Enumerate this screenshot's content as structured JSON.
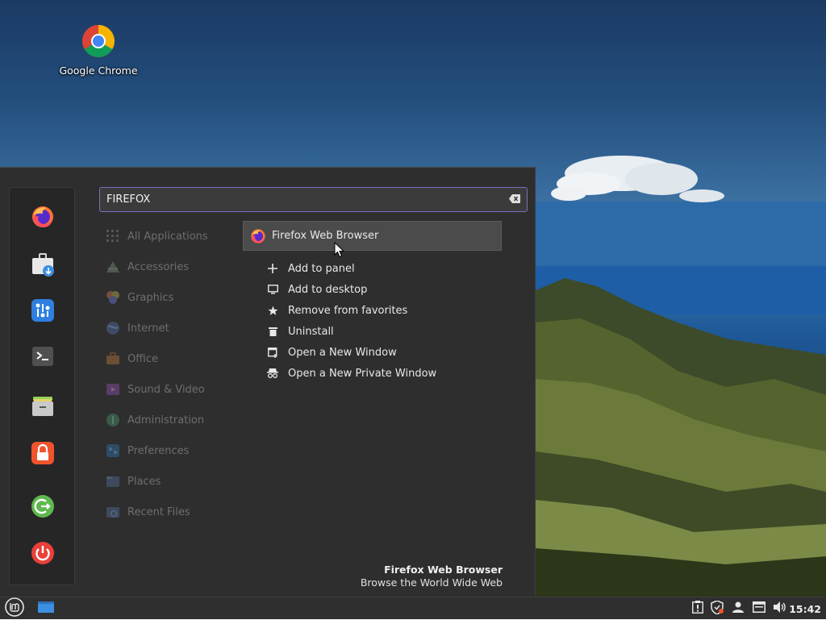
{
  "desktop": {
    "icons": [
      {
        "label": "Google Chrome",
        "icon": "chrome-icon"
      }
    ]
  },
  "menu": {
    "favorites": [
      {
        "name": "Firefox",
        "icon": "firefox-icon"
      },
      {
        "name": "Software Manager",
        "icon": "software-manager-icon"
      },
      {
        "name": "Settings",
        "icon": "settings-icon"
      },
      {
        "name": "Terminal",
        "icon": "terminal-icon"
      },
      {
        "name": "Files",
        "icon": "files-icon"
      },
      {
        "name": "Lock Screen",
        "icon": "lock-icon"
      },
      {
        "name": "Log Out",
        "icon": "logout-icon"
      },
      {
        "name": "Quit",
        "icon": "power-icon"
      }
    ],
    "search": {
      "value": "FIREFOX"
    },
    "categories": [
      {
        "label": "All Applications",
        "icon": "grid-icon"
      },
      {
        "label": "Accessories",
        "icon": "accessories-icon"
      },
      {
        "label": "Graphics",
        "icon": "graphics-icon"
      },
      {
        "label": "Internet",
        "icon": "internet-icon"
      },
      {
        "label": "Office",
        "icon": "office-icon"
      },
      {
        "label": "Sound & Video",
        "icon": "sound-video-icon"
      },
      {
        "label": "Administration",
        "icon": "administration-icon"
      },
      {
        "label": "Preferences",
        "icon": "preferences-icon"
      },
      {
        "label": "Places",
        "icon": "places-icon"
      },
      {
        "label": "Recent Files",
        "icon": "recent-files-icon"
      }
    ],
    "result": {
      "label": "Firefox Web Browser",
      "icon": "firefox-icon"
    },
    "actions": [
      {
        "label": "Add to panel",
        "icon": "plus-icon"
      },
      {
        "label": "Add to desktop",
        "icon": "monitor-icon"
      },
      {
        "label": "Remove from favorites",
        "icon": "star-icon"
      },
      {
        "label": "Uninstall",
        "icon": "trash-icon"
      },
      {
        "label": "Open a New Window",
        "icon": "new-window-icon"
      },
      {
        "label": "Open a New Private Window",
        "icon": "private-window-icon"
      }
    ],
    "description": {
      "title": "Firefox Web Browser",
      "subtitle": "Browse the World Wide Web"
    }
  },
  "panel": {
    "clock": "15:42",
    "tray": [
      "notes-icon",
      "shield-icon",
      "user-icon",
      "display-icon",
      "volume-icon"
    ]
  },
  "colors": {
    "accent": "#7f6fbf",
    "menu_bg": "#2e2e2e",
    "mint_green": "#5fb84e"
  }
}
